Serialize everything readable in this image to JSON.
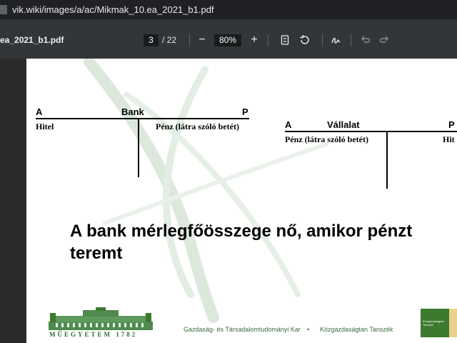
{
  "browser": {
    "url": "vik.wiki/images/a/ac/Mikmak_10.ea_2021_b1.pdf"
  },
  "pdf_toolbar": {
    "filename": "ea_2021_b1.pdf",
    "current_page": "3",
    "total_pages": "/ 22",
    "zoom": "80%",
    "zoom_out_label": "−",
    "zoom_in_label": "+"
  },
  "slide": {
    "bank_account": {
      "left_label": "A",
      "title": "Bank",
      "right_label": "P",
      "debit_entry": "Hitel",
      "credit_entry": "Pénz (látra szóló betét)"
    },
    "company_account": {
      "left_label": "A",
      "title": "Vállalat",
      "right_label": "P",
      "debit_entry": "Pénz (látra szóló betét)",
      "credit_entry": "Hit"
    },
    "headline_line1": "A bank mérlegfőösszege nő, amikor pénzt",
    "headline_line2": "teremt",
    "footer": {
      "logo_caption": "MŰEGYETEM 1782",
      "faculty": "Gazdaság- és Társadalomtudományi Kar",
      "bullet": "•",
      "department": "Közgazdaságtan Tanszék",
      "right_logo_text": "Közgazdaságtan Tanszék"
    }
  },
  "colors": {
    "toolbar_bg": "#323639",
    "urlbar_bg": "#202124",
    "footer_green": "#3b6b3b",
    "logo_green": "#3c7a2e"
  }
}
